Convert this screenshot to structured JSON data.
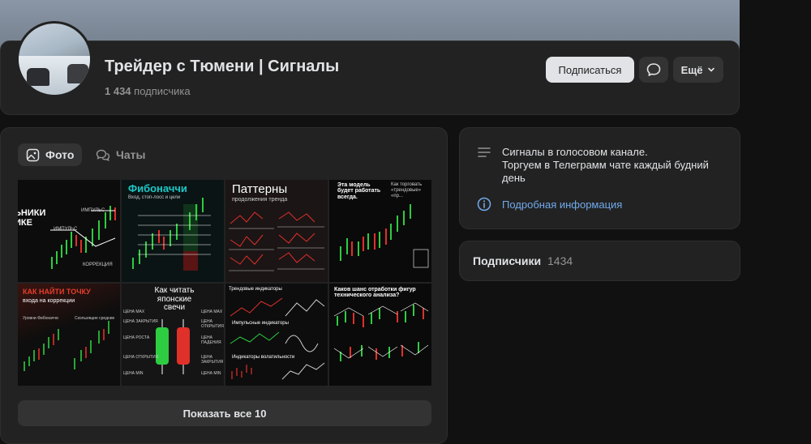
{
  "header": {
    "title": "Трейдер с Тюмени | Сигналы",
    "subscribers_count": "1 434",
    "subscribers_word": "подписчика",
    "subscribe_label": "Подписаться",
    "more_label": "Ещё"
  },
  "tabs": [
    {
      "label": "Фото",
      "active": true
    },
    {
      "label": "Чаты",
      "active": false
    }
  ],
  "photos": [
    {
      "title": "ЬНИКИ\nИКЕ",
      "labels": [
        "ИМПУЛЬС",
        "ИМПУЛЬС",
        "КОРРЕКЦИЯ"
      ]
    },
    {
      "title": "Фибоначчи",
      "subtitle": "Вход, стоп-лосс и цели"
    },
    {
      "title": "Паттерны",
      "subtitle": "продолжения тренда"
    },
    {
      "title": "Эта модель будет работать всегда.",
      "subtitle": "Как торговать «трендовые» «пр..."
    },
    {
      "title": "КАК НАЙТИ ТОЧКУ",
      "subtitle": "входа на коррекции",
      "labels": [
        "Уровни Фибоначчи",
        "Скользящие средние"
      ]
    },
    {
      "title": "Как читать японские свечи",
      "labels": [
        "ЦЕНА ЗАКРЫТИЯ",
        "ЦЕНА ОТКРЫТИЯ",
        "ЦЕНА РОСТА",
        "ЦЕНА ПАДЕНИЯ",
        "ЦЕНА ОТКРЫТИЯ",
        "ЦЕНА ЗАКРЫТИЯ",
        "ЦЕНА MIN",
        "ЦЕНА MIN",
        "ЦЕНА MAX",
        "ЦЕНА MAX"
      ]
    },
    {
      "title": "Трендовые индикаторы",
      "labels": [
        "Импульсные индикаторы",
        "Индикаторы волатильности"
      ]
    },
    {
      "title": "Каков шанс отработки фигур технического анализа?"
    }
  ],
  "show_all_label": "Показать все 10",
  "info": {
    "description_line1": "Сигналы в голосовом канале.",
    "description_line2": "Торгуем в Телеграмм чате каждый будний день",
    "details_link": "Подробная информация"
  },
  "subscribers_block": {
    "label": "Подписчики",
    "count": "1434"
  },
  "colors": {
    "background": "#111111",
    "card": "#222222",
    "button": "#333333",
    "link": "#71aaeb",
    "green": "#2ecc40",
    "red": "#e0302a"
  }
}
